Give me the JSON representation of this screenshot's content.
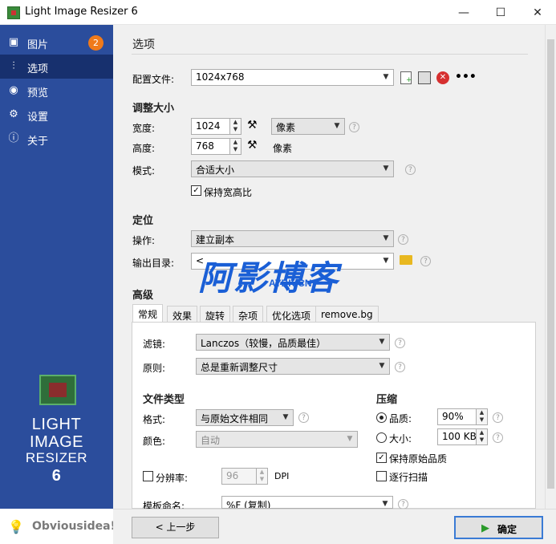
{
  "window": {
    "title": "Light Image Resizer 6",
    "minimize": "—",
    "maximize": "☐",
    "close": "✕"
  },
  "sidebar": {
    "items": [
      {
        "label": "图片",
        "icon": "images-icon",
        "badge": "2"
      },
      {
        "label": "选项",
        "icon": "sliders-icon"
      },
      {
        "label": "预览",
        "icon": "eye-icon"
      },
      {
        "label": "设置",
        "icon": "gear-icon"
      },
      {
        "label": "关于",
        "icon": "info-icon"
      }
    ],
    "logo_lines": [
      "LIGHT",
      "IMAGE",
      "RESIZER",
      "6"
    ],
    "brand": "Obviousidea!"
  },
  "main": {
    "title": "选项",
    "profile": {
      "label": "配置文件:",
      "value": "1024x768"
    },
    "resize": {
      "heading": "调整大小",
      "width_label": "宽度:",
      "width_value": "1024",
      "unit_value": "像素",
      "height_label": "高度:",
      "height_value": "768",
      "height_unit": "像素",
      "mode_label": "模式:",
      "mode_value": "合适大小",
      "keep_ratio_label": "保持宽高比",
      "keep_ratio_checked": true
    },
    "location": {
      "heading": "定位",
      "action_label": "操作:",
      "action_value": "建立副本",
      "output_label": "输出目录:",
      "output_value": "<"
    },
    "advanced": {
      "heading": "高级",
      "tabs": [
        "常规",
        "效果",
        "旋转",
        "杂项",
        "优化选项",
        "remove.bg"
      ],
      "filter_label": "滤镜:",
      "filter_value": "Lanczos（较慢，品质最佳）",
      "rule_label": "原则:",
      "rule_value": "总是重新调整尺寸",
      "filetype_heading": "文件类型",
      "format_label": "格式:",
      "format_value": "与原始文件相同",
      "color_label": "颜色:",
      "color_value": "自动",
      "resolution_label": "分辨率:",
      "resolution_value": "96",
      "dpi_label": "DPI",
      "template_label": "模板命名:",
      "template_value": "%F (复制)",
      "compression_heading": "压缩",
      "quality_label": "品质:",
      "quality_value": "90%",
      "size_label": "大小:",
      "size_value": "100 KB",
      "keep_quality_label": "保持原始品质",
      "keep_quality_checked": true,
      "progressive_label": "逐行扫描"
    }
  },
  "footer": {
    "back_label": "< 上一步",
    "ok_label": "确定"
  },
  "watermark": {
    "text": "阿影博客",
    "sub": "AYBK.CN"
  },
  "colors": {
    "sidebar": "#2b4d9c",
    "sidebar_active": "#17306e",
    "badge": "#f07a1a",
    "ok_border": "#3a7bd5"
  }
}
